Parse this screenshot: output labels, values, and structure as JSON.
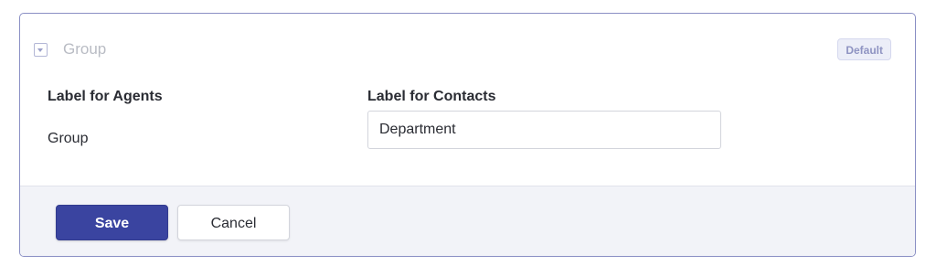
{
  "field": {
    "name": "Group",
    "badge": "Default",
    "toggle_icon": "chevron-down-icon"
  },
  "columns": {
    "agents_label": "Label for Agents",
    "contacts_label": "Label for Contacts"
  },
  "values": {
    "agents_value": "Group",
    "contacts_value": "Department"
  },
  "footer": {
    "save_label": "Save",
    "cancel_label": "Cancel"
  },
  "colors": {
    "accent": "#3a44a0",
    "border": "#8a8fc4",
    "footer_bg": "#f2f3f8"
  }
}
